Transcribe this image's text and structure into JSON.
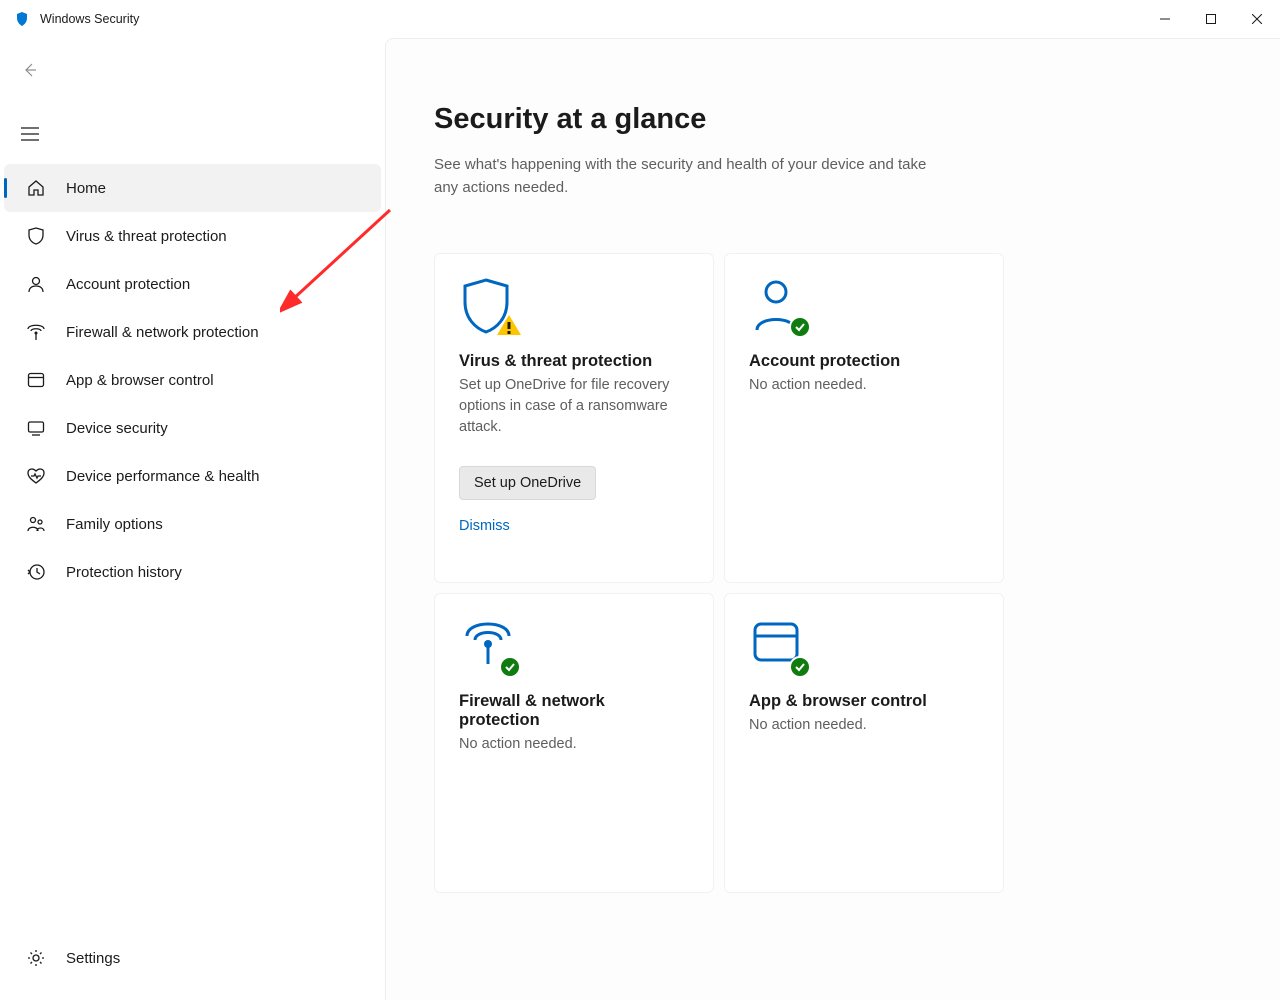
{
  "app": {
    "title": "Windows Security"
  },
  "sidebar": {
    "items": [
      {
        "label": "Home"
      },
      {
        "label": "Virus & threat protection"
      },
      {
        "label": "Account protection"
      },
      {
        "label": "Firewall & network protection"
      },
      {
        "label": "App & browser control"
      },
      {
        "label": "Device security"
      },
      {
        "label": "Device performance & health"
      },
      {
        "label": "Family options"
      },
      {
        "label": "Protection history"
      }
    ],
    "settings_label": "Settings"
  },
  "main": {
    "title": "Security at a glance",
    "subtitle": "See what's happening with the security and health of your device and take any actions needed."
  },
  "cards": {
    "virus": {
      "title": "Virus & threat protection",
      "body": "Set up OneDrive for file recovery options in case of a ransomware attack.",
      "button": "Set up OneDrive",
      "dismiss": "Dismiss"
    },
    "account": {
      "title": "Account protection",
      "body": "No action needed."
    },
    "firewall": {
      "title": "Firewall & network protection",
      "body": "No action needed."
    },
    "apps": {
      "title": "App & browser control",
      "body": "No action needed."
    }
  }
}
